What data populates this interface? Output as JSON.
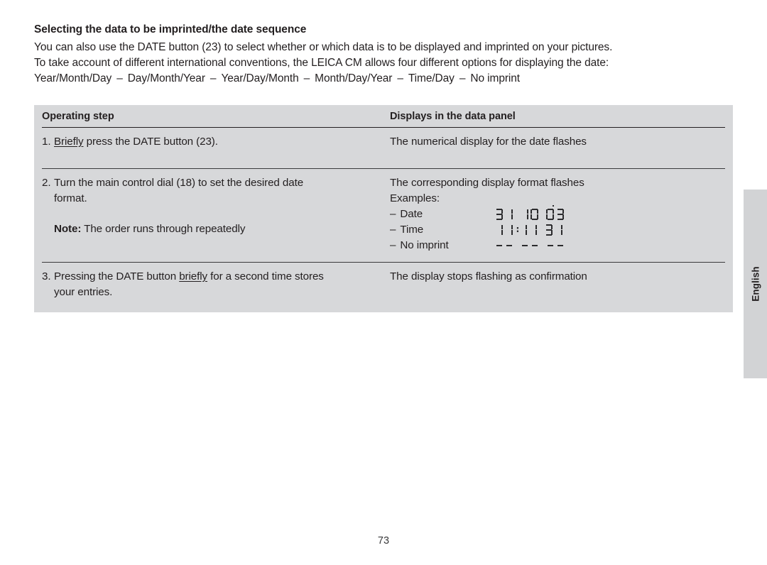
{
  "document": {
    "section_title": "Selecting the data to be imprinted/the date sequence",
    "intro_paragraph_line1": "You can also use the DATE button (23) to select whether or which data is to be displayed and imprinted on your pictures.",
    "intro_paragraph_line2": "To take account of different international conventions, the LEICA CM allows four different options for displaying the date:",
    "date_format_options": [
      "Year/Month/Day",
      "Day/Month/Year",
      "Year/Day/Month",
      "Month/Day/Year",
      "Time/Day",
      "No imprint"
    ],
    "format_separator": "–",
    "page_number": "73",
    "side_tab_label": "English"
  },
  "table": {
    "headers": {
      "operating_step": "Operating step",
      "displays": "Displays in the data panel"
    },
    "rows": [
      {
        "number": "1.",
        "step_prefix": "",
        "step_underlined": "Briefly",
        "step_suffix": " press the DATE button (23).",
        "display": "The numerical display for the date flashes"
      },
      {
        "number": "2.",
        "step_line1": "Turn the main control dial (18) to set the desired date",
        "step_line2": "format.",
        "note_label": "Note:",
        "note_text": " The order runs through repeatedly",
        "display_line1": "The corresponding display format flashes",
        "display_line2": "Examples:",
        "examples": [
          {
            "dash": "–",
            "label": "Date",
            "lcd_value": "31 10 03"
          },
          {
            "dash": "–",
            "label": "Time",
            "lcd_value": "11:11 31"
          },
          {
            "dash": "–",
            "label": "No imprint",
            "lcd_value": "-- -- --"
          }
        ]
      },
      {
        "number": "3.",
        "step_prefix": "Pressing the DATE button ",
        "step_underlined": "briefly",
        "step_suffix": " for a second time stores",
        "step_line2": "your entries.",
        "display": "The display stops flashing as confirmation"
      }
    ]
  },
  "colors": {
    "table_background": "#d7d8da",
    "side_tab_background": "#d2d3d5",
    "text": "#231f20",
    "rule": "#231f20"
  }
}
